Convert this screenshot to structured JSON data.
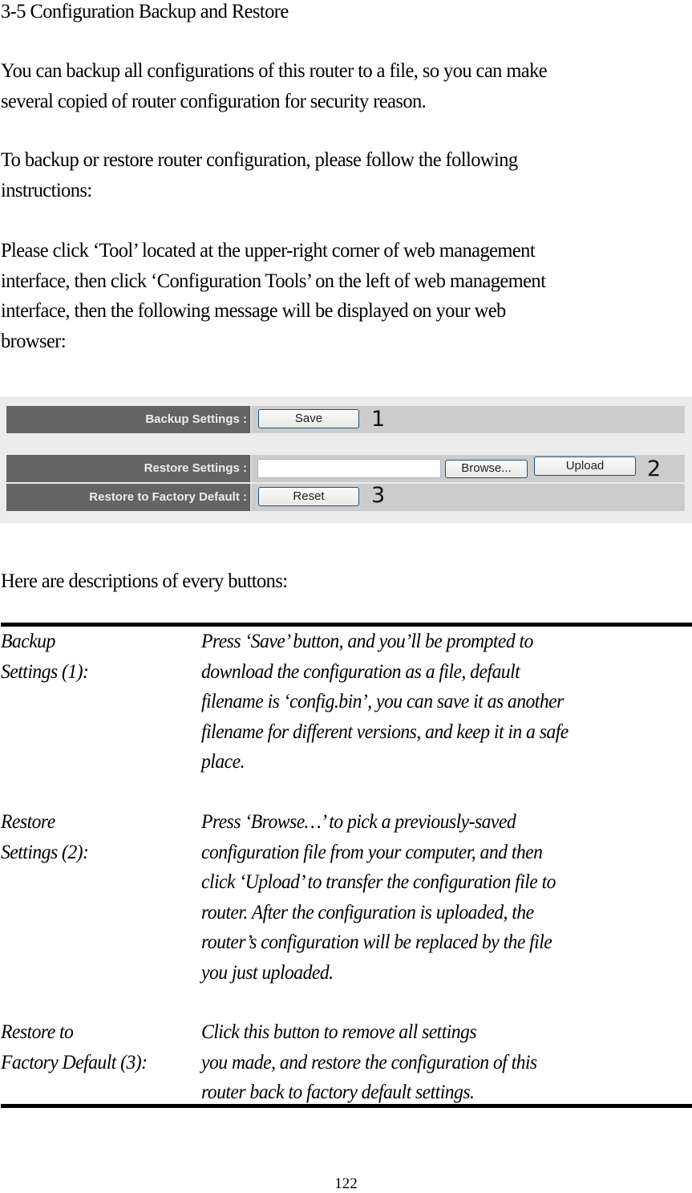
{
  "document": {
    "section_title": "3-5 Configuration Backup and Restore",
    "paragraphs": [
      [
        "You can backup all configurations of this router to a file, so you can make",
        "several copied of router configuration for security reason."
      ],
      [
        "To backup or restore router configuration, please follow the following",
        "instructions:"
      ],
      [
        "Please click ‘Tool’ located at the upper-right corner of web management",
        "interface, then click ‘Configuration Tools’ on the left of web management",
        "interface, then the following message will be displayed on your web",
        "browser:"
      ]
    ],
    "descriptions_intro": "Here are descriptions of every buttons:",
    "page_number": "122"
  },
  "screenshot": {
    "rows": [
      {
        "label": "Backup Settings :",
        "button": "Save",
        "callout": "1"
      },
      {
        "label": "Restore Settings :",
        "file_input_value": "",
        "browse_button": "Browse...",
        "button": "Upload",
        "callout": "2"
      },
      {
        "label": "Restore to Factory Default :",
        "button": "Reset",
        "callout": "3"
      }
    ]
  },
  "descriptions": [
    {
      "term": [
        "Backup",
        "Settings (1):"
      ],
      "definition": [
        "Press ‘Save’ button, and you’ll be prompted to",
        "download the configuration as a file, default",
        "filename is ‘config.bin’, you can save it as another",
        "filename for different versions, and keep it in a safe",
        "place."
      ]
    },
    {
      "term": [
        "Restore",
        "Settings (2):"
      ],
      "definition": [
        "Press ‘Browse…’ to pick a previously-saved",
        "configuration file from your computer, and then",
        "click ‘Upload’ to transfer the configuration file to",
        "router. After the configuration is uploaded, the",
        "router’s configuration will be replaced by the file",
        "you just uploaded."
      ]
    },
    {
      "term": [
        "Restore to",
        "Factory Default (3):"
      ],
      "definition": [
        "Click this button to remove all settings",
        "you made, and restore the configuration of this",
        "router back to factory default settings."
      ]
    }
  ]
}
